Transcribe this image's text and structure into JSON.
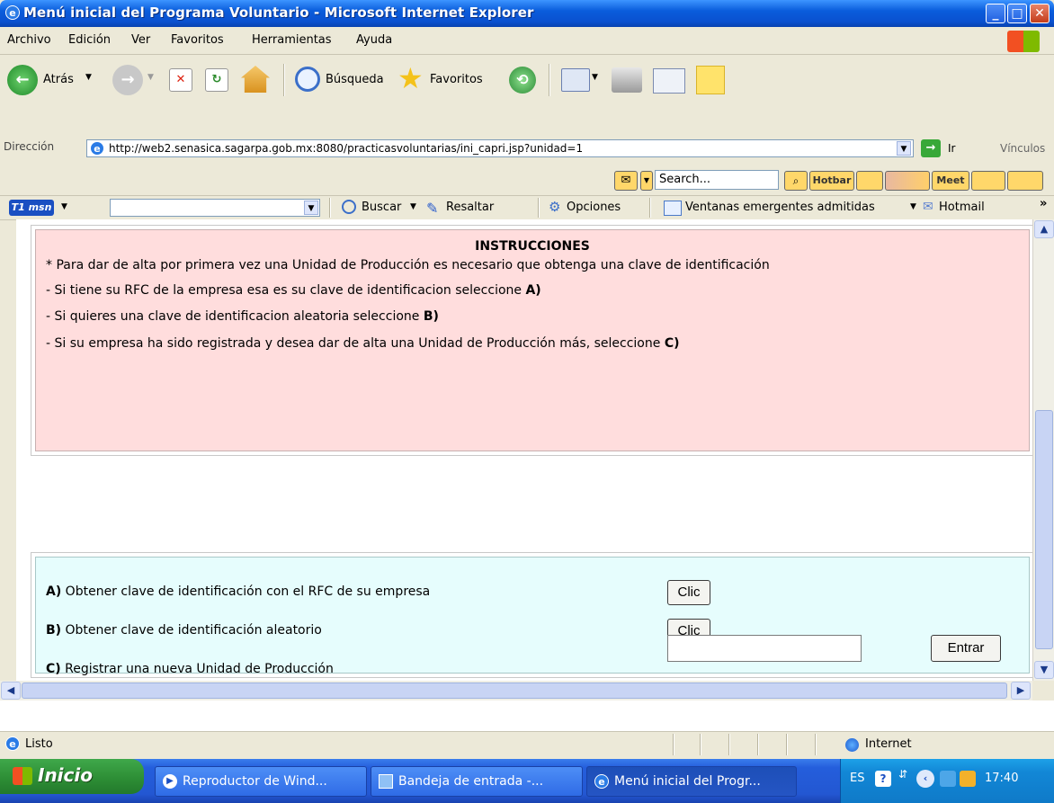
{
  "window": {
    "title": "Menú inicial del Programa Voluntario - Microsoft Internet Explorer",
    "min": "_",
    "max": "□",
    "close": "✕"
  },
  "menu": [
    "Archivo",
    "Edición",
    "Ver",
    "Favoritos",
    "Herramientas",
    "Ayuda"
  ],
  "toolbar": {
    "back": "Atrás",
    "search": "Búsqueda",
    "favorites": "Favoritos"
  },
  "address": {
    "label": "Dirección",
    "url": "http://web2.senasica.sagarpa.gob.mx:8080/practicasvoluntarias/ini_capri.jsp?unidad=1",
    "go": "Ir",
    "links": "Vínculos"
  },
  "hotbar": {
    "search_placeholder": "Search...",
    "hotbar_label": "Hotbar",
    "meet": "Meet"
  },
  "msnbar": {
    "logo": "T1 msn",
    "search": "Buscar",
    "highlight": "Resaltar",
    "options": "Opciones",
    "popups": "Ventanas emergentes admitidas",
    "hotmail": "Hotmail",
    "more": "»"
  },
  "instructions": {
    "heading": "INSTRUCCIONES",
    "line1": "* Para dar de alta por primera vez una Unidad de Producción es necesario que obtenga una clave de identificación",
    "line2_prefix": "- Si tiene su RFC de la empresa esa es su clave de identificacion seleccione ",
    "line2_bold": "A)",
    "line3_prefix": "- Si quieres una clave de identificacion aleatoria seleccione ",
    "line3_bold": "B)",
    "line4_prefix": "- Si su empresa ha sido registrada y desea dar de alta una Unidad de Producción más, seleccione ",
    "line4_bold": "C)"
  },
  "options": {
    "a_bold": "A)",
    "a_text": " Obtener clave de identificación con el RFC de su empresa",
    "a_button": "Clic",
    "b_bold": "B)",
    "b_text": " Obtener clave de identificación aleatorio",
    "b_button": "Clic",
    "c_bold": "C)",
    "c_text": " Registrar una nueva Unidad de Producción",
    "c_value": "",
    "c_button": "Entrar"
  },
  "status": {
    "text": "Listo",
    "zone": "Internet"
  },
  "taskbar": {
    "start": "Inicio",
    "tasks": [
      "Reproductor de Wind...",
      "Bandeja de entrada -...",
      "Menú inicial del Progr..."
    ],
    "lang": "ES",
    "clock": "17:40"
  },
  "colors": {
    "instructions_bg": "#ffdddd",
    "options_bg": "#e6fdfd",
    "titlebar": "#0a5ddc"
  }
}
